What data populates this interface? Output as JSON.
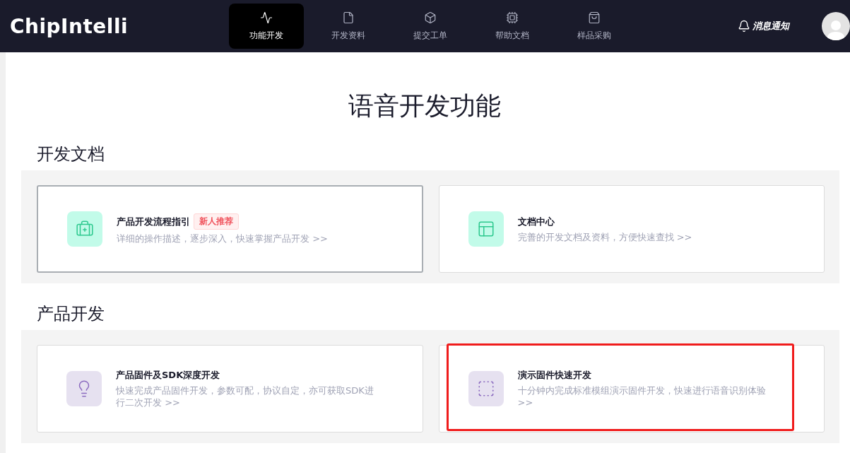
{
  "header": {
    "logo": "ChipIntelli",
    "nav": [
      {
        "label": "功能开发",
        "kind": "pulse",
        "selected": true
      },
      {
        "label": "开发资料",
        "kind": "file",
        "selected": false
      },
      {
        "label": "提交工单",
        "kind": "box",
        "selected": false
      },
      {
        "label": "帮助文档",
        "kind": "chip",
        "selected": false
      },
      {
        "label": "样品采购",
        "kind": "bag",
        "selected": false
      }
    ],
    "notification": "消息通知"
  },
  "page_title": "语音开发功能",
  "sections": [
    {
      "heading": "开发文档",
      "cards": [
        {
          "title": "产品开发流程指引",
          "badge": "新人推荐",
          "description": "详细的操作描述，逐步深入，快速掌握产品开发 >>",
          "kind": "kit",
          "hovered": true,
          "highlighted": false
        },
        {
          "title": "文档中心",
          "description": "完善的开发文档及资料，方便快速查找 >>",
          "kind": "layout",
          "hovered": false,
          "highlighted": false
        }
      ]
    },
    {
      "heading": "产品开发",
      "cards": [
        {
          "title": "产品固件及SDK深度开发",
          "description": "快速完成产品固件开发，参数可配，协议自定，亦可获取SDK进行二次开发 >>",
          "kind": "bulb",
          "hovered": false,
          "highlighted": false
        },
        {
          "title": "演示固件快速开发",
          "description": "十分钟内完成标准模组演示固件开发，快速进行语音识别体验 >>",
          "kind": "frame",
          "hovered": false,
          "highlighted": true
        }
      ]
    }
  ]
}
